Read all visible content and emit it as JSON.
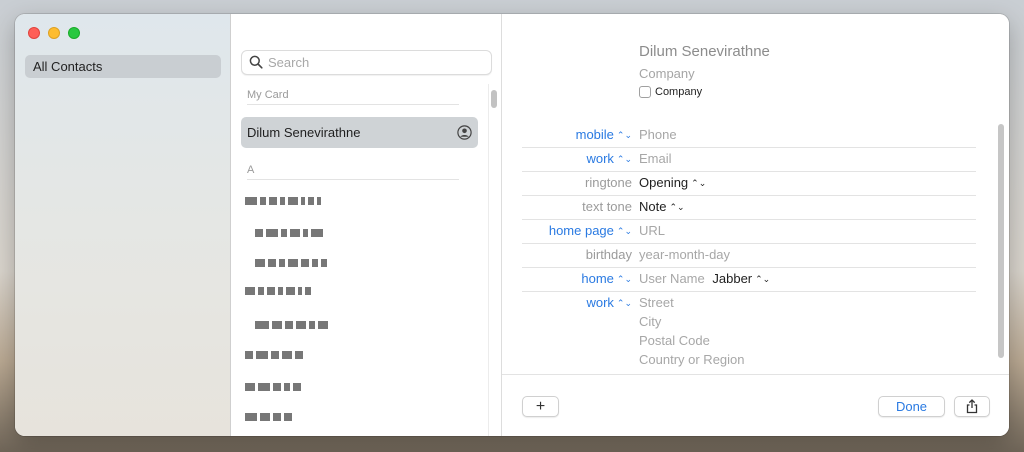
{
  "sidebar": {
    "items": [
      {
        "label": "All Contacts"
      }
    ]
  },
  "list": {
    "search_placeholder": "Search",
    "my_card_header": "My Card",
    "my_card_name": "Dilum Senevirathne",
    "section_a": "A"
  },
  "detail": {
    "name": "Dilum  Senevirathne",
    "company_placeholder": "Company",
    "company_checkbox_label": "Company",
    "fields": [
      {
        "label": "mobile",
        "label_style": "blue",
        "value": "Phone",
        "value_style": "placeholder"
      },
      {
        "label": "work",
        "label_style": "blue",
        "value": "Email",
        "value_style": "placeholder"
      },
      {
        "label": "ringtone",
        "label_style": "grey",
        "value": "Opening",
        "value_style": "dark"
      },
      {
        "label": "text tone",
        "label_style": "grey",
        "value": "Note",
        "value_style": "dark"
      },
      {
        "label": "home page",
        "label_style": "blue",
        "value": "URL",
        "value_style": "placeholder"
      },
      {
        "label": "birthday",
        "label_style": "grey",
        "value": "year-month-day",
        "value_style": "placeholder"
      },
      {
        "label": "home",
        "label_style": "blue",
        "value": "User Name",
        "value_style": "placeholder",
        "service": "Jabber"
      }
    ],
    "address": {
      "label": "work",
      "street": "Street",
      "city": "City",
      "postal": "Postal Code",
      "country": "Country or Region"
    },
    "buttons": {
      "add": "+",
      "done": "Done"
    }
  },
  "colors": {
    "accent": "#2a7ae2",
    "selection": "#cfd3d6"
  }
}
